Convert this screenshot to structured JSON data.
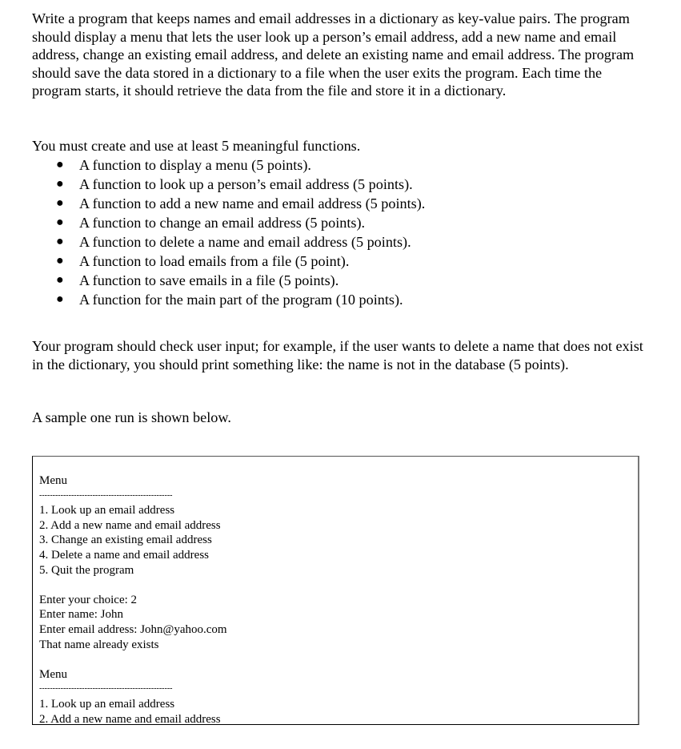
{
  "intro": {
    "paragraph": "Write a program that keeps names and email addresses in a dictionary as key-value pairs. The program should display a menu that lets the user look up a person’s email address, add a new name and email address, change an existing email address, and delete an existing name and email address. The program should save the data stored in a dictionary to a file when the user exits the program. Each time the program starts, it should retrieve the data from the file and store it in a dictionary."
  },
  "requirements": {
    "title": "You must create and use at least 5 meaningful functions.",
    "items": [
      "A function to display a menu (5 points).",
      "A function to look up a person’s email address (5 points).",
      "A function to add a new name and email address (5 points).",
      "A function to change an email address (5 points).",
      "A function to delete a name and email address (5 points).",
      "A function to load emails from a file (5 point).",
      "A function to save emails in a file (5 points).",
      "A function for the main part of the program (10 points)."
    ]
  },
  "input_check": {
    "paragraph": "Your program should check user input; for example, if the user wants to delete a name that does not exist in the dictionary, you should print something like: the name is not in the database (5 points)."
  },
  "sample_intro": "A sample one run is shown below.",
  "sample_run": {
    "lines": [
      "Menu",
      "--------------------------------------------------",
      "1. Look up an email address",
      "2. Add a new name and email address",
      "3. Change an existing email address",
      "4. Delete a name and email address",
      "5. Quit the program",
      "",
      "Enter your choice: 2",
      "Enter name: John",
      "Enter email address: John@yahoo.com",
      "That name already exists",
      "",
      "Menu",
      "--------------------------------------------------",
      "1. Look up an email address",
      "2. Add a new name and email address"
    ]
  }
}
